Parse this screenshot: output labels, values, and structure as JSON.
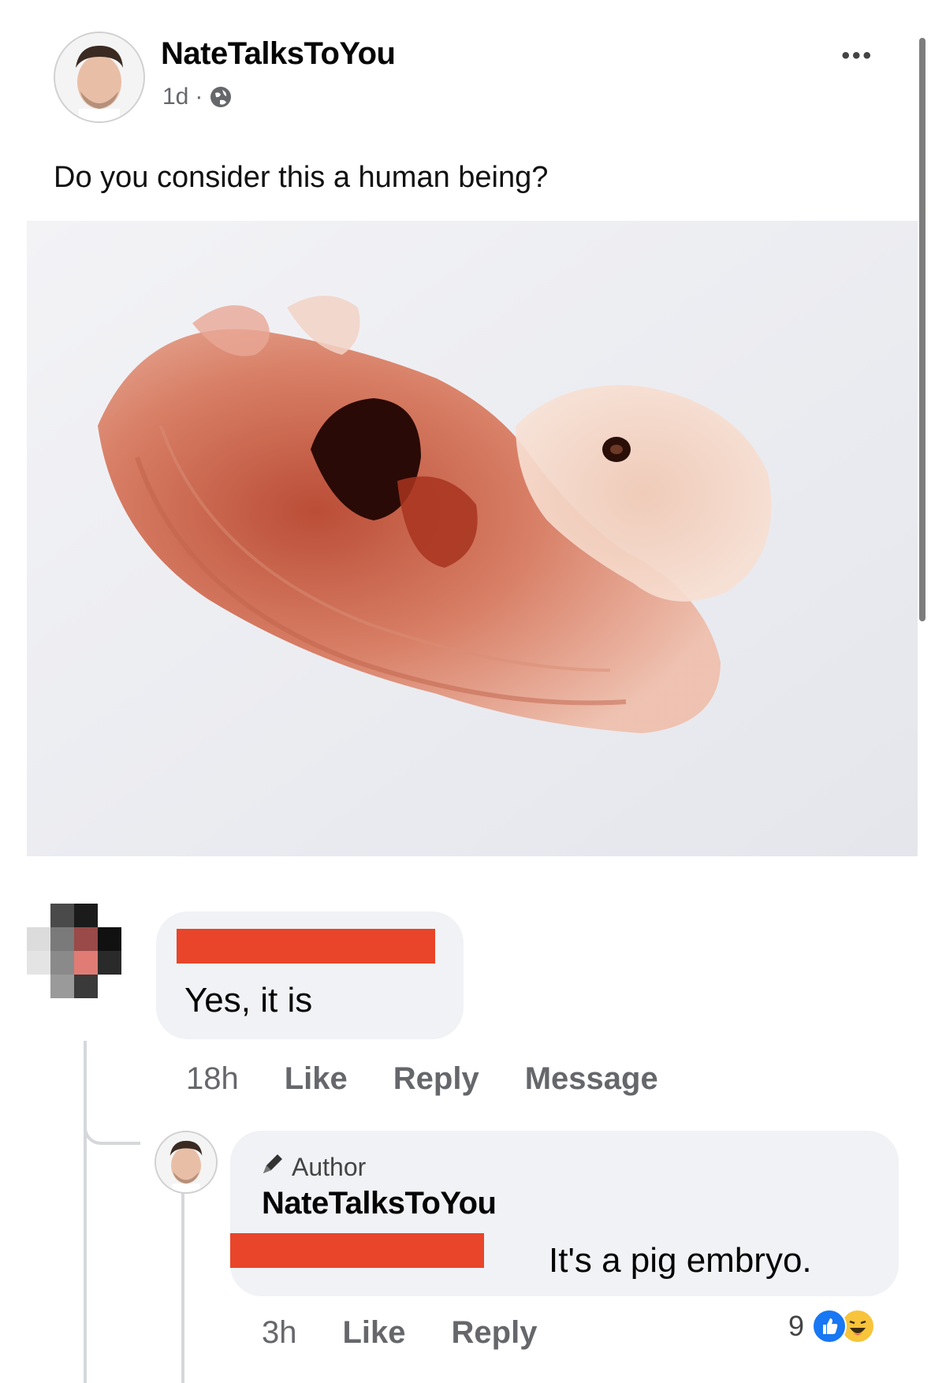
{
  "post": {
    "author": "NateTalksToYou",
    "time": "1d",
    "separator": "·",
    "more": "•••",
    "text": "Do you consider this a human being?"
  },
  "comments": [
    {
      "text": "Yes, it is",
      "time": "18h",
      "actions": [
        "Like",
        "Reply",
        "Message"
      ]
    },
    {
      "badge": "Author",
      "author": "NateTalksToYou",
      "text": "It's a pig embryo.",
      "time": "3h",
      "actions": [
        "Like",
        "Reply"
      ],
      "reaction_count": "9",
      "reaction_icons": [
        "like-icon",
        "haha-icon"
      ]
    }
  ],
  "colors": {
    "redaction": "#e8452a",
    "bubble": "#f0f2f5",
    "like_blue": "#1877f2",
    "haha_yellow": "#f7c43b"
  }
}
